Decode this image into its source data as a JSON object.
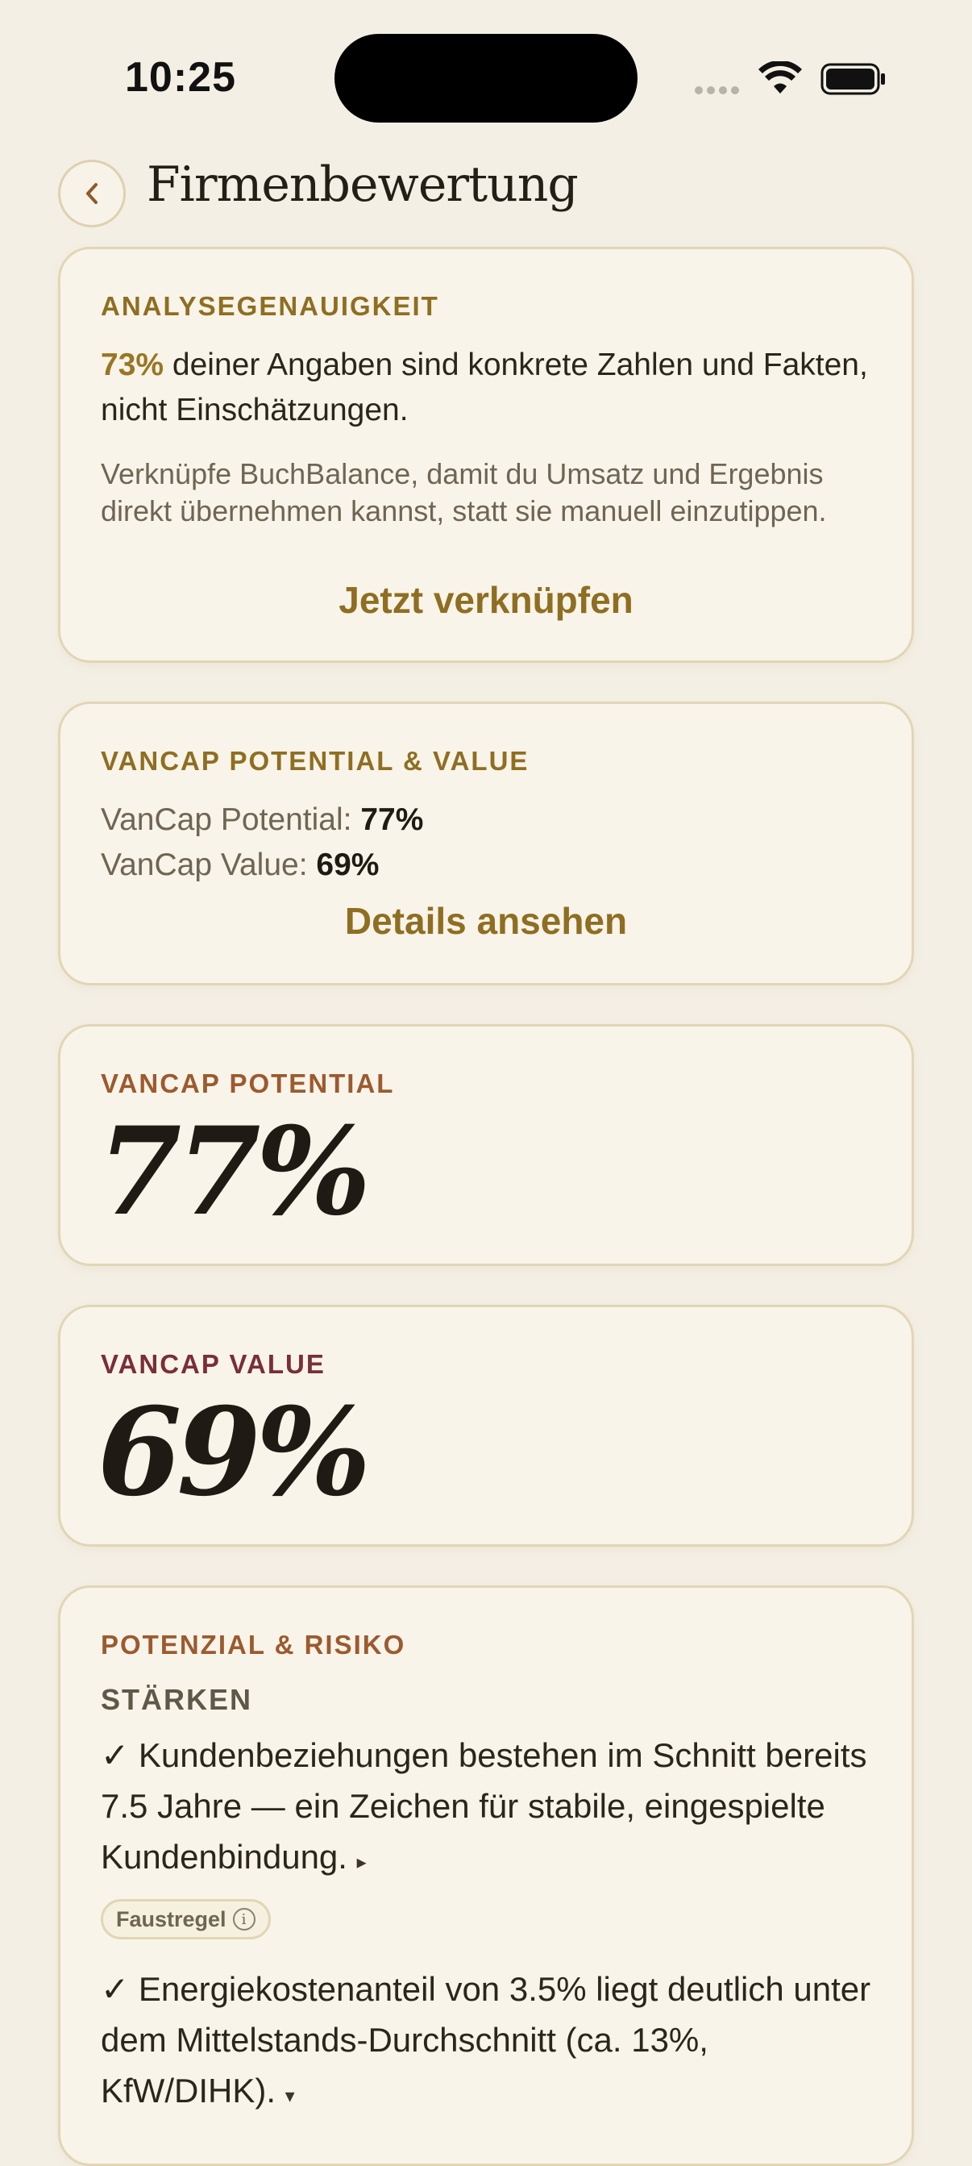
{
  "status": {
    "time": "10:25"
  },
  "nav": {
    "back_icon": "chevron-left-icon",
    "title": "Firmenbewertung"
  },
  "accuracy_card": {
    "eyebrow": "ANALYSEGENAUIGKEIT",
    "percent": "73%",
    "statement": " deiner Angaben sind konkrete Zahlen und Fakten, nicht Einschätzungen.",
    "hint": "Verknüpfe BuchBalance, damit du Umsatz und Ergebnis direkt übernehmen kannst, statt sie manuell einzutippen.",
    "action": "Jetzt verknüpfen"
  },
  "summary_card": {
    "eyebrow": "VANCAP POTENTIAL & VALUE",
    "potential_label": "VanCap Potential: ",
    "potential_value": "77%",
    "value_label": "VanCap Value: ",
    "value_value": "69%",
    "action": "Details ansehen"
  },
  "potential_card": {
    "eyebrow": "VANCAP POTENTIAL",
    "value": "77%"
  },
  "value_card": {
    "eyebrow": "VANCAP VALUE",
    "value": "69%"
  },
  "risk_card": {
    "eyebrow": "POTENZIAL & RISIKO",
    "strengths_heading": "STÄRKEN",
    "strengths": [
      {
        "text": "✓ Kundenbeziehungen bestehen im Schnitt bereits 7.5 Jahre — ein Zeichen für stabile, eingespielte Kundenbindung.",
        "toggle": "▸"
      },
      {
        "text": "✓ Energiekostenanteil von 3.5% liegt deutlich unter dem Mittelstands-Durchschnitt (ca. 13%, KfW/DIHK).",
        "toggle": "▾"
      }
    ],
    "chip_label": "Faustregel",
    "chip_icon": "info-icon"
  },
  "colors": {
    "background": "#f4efe4",
    "card": "#f8f4e9",
    "card_border": "#e1d6b4",
    "gold": "#8f6e22",
    "rust": "#9c5a2f",
    "wine": "#7a2e37"
  }
}
